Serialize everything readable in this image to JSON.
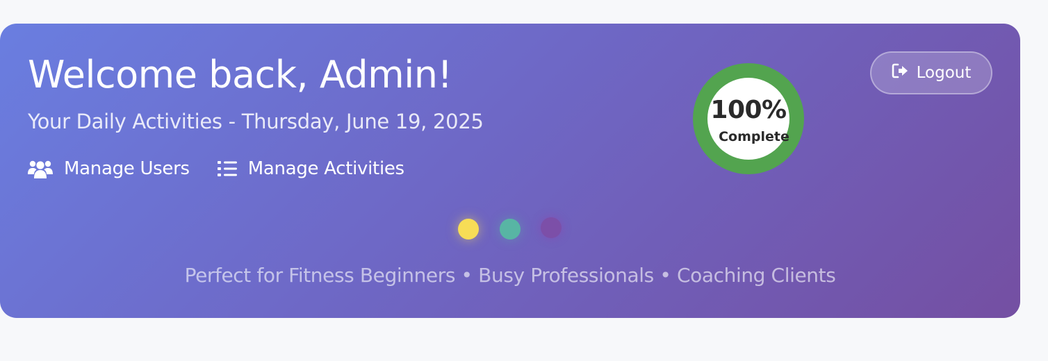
{
  "header": {
    "title": "Welcome back, Admin!",
    "subtitle": "Your Daily Activities - Thursday, June 19, 2025",
    "nav": [
      {
        "label": "Manage Users",
        "icon": "users-icon"
      },
      {
        "label": "Manage Activities",
        "icon": "list-icon"
      }
    ]
  },
  "progress": {
    "value_text": "100%",
    "label": "Complete",
    "percent": 100,
    "ring_color": "#53a44f"
  },
  "logout": {
    "label": "Logout",
    "icon": "sign-out-icon"
  },
  "indicators": [
    {
      "name": "yellow-dot",
      "color": "#f7dd56"
    },
    {
      "name": "teal-dot",
      "color": "#58b5a4"
    },
    {
      "name": "purple-dot",
      "color": "#7c4fa8"
    }
  ],
  "tagline": "Perfect for Fitness Beginners • Busy Professionals • Coaching Clients",
  "colors": {
    "gradient_start": "#6a7ee0",
    "gradient_end": "#744fa2",
    "page_background": "#f7f8fa"
  }
}
